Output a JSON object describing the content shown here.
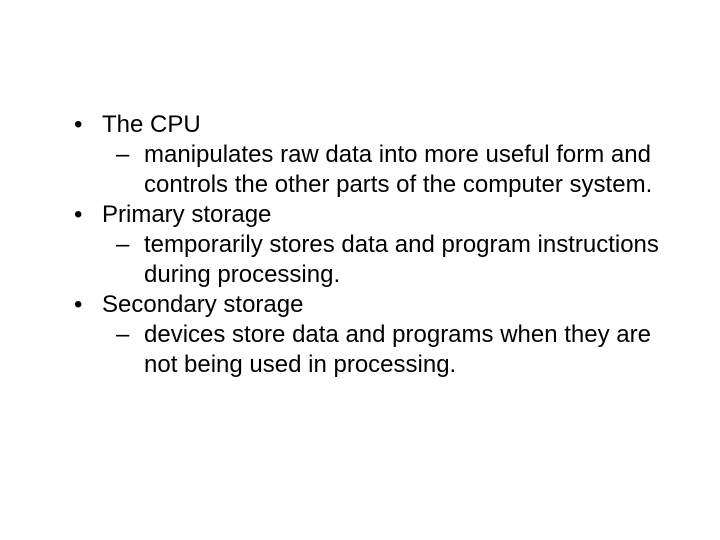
{
  "bullets": [
    {
      "title": "The CPU",
      "sub": "manipulates raw data into more useful form and controls the other parts of the computer system."
    },
    {
      "title": "Primary storage",
      "sub": "temporarily stores data and program instructions during processing."
    },
    {
      "title": "Secondary storage",
      "sub": "devices store data and programs when they are not being used in processing."
    }
  ],
  "marks": {
    "bullet": "•",
    "dash": "–"
  }
}
